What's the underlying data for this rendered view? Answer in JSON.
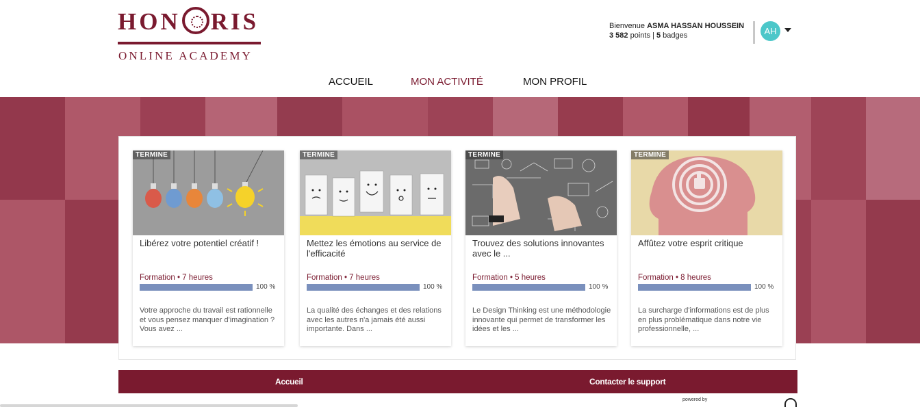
{
  "brand": {
    "logo_word": "HON",
    "logo_word_end": "RIS",
    "tagline": "ONLINE ACADEMY",
    "color": "#7a1a2f"
  },
  "user": {
    "greeting": "Bienvenue",
    "name": "ASMA HASSAN HOUSSEIN",
    "points_value": "3 582",
    "points_label": "points",
    "separator": "|",
    "badges_value": "5",
    "badges_label": "badges",
    "avatar_initials": "AH",
    "avatar_color": "#4cc7c9",
    "menu_icon": "caret-down-icon"
  },
  "nav": {
    "items": [
      {
        "label": "ACCUEIL",
        "active": false
      },
      {
        "label": "MON ACTIVITÉ",
        "active": true
      },
      {
        "label": "MON PROFIL",
        "active": false
      }
    ]
  },
  "courses": [
    {
      "status": "TERMINE",
      "title": "Libérez votre potentiel créatif !",
      "meta": "Formation • 7 heures",
      "progress": 1.0,
      "progress_label": "100 %",
      "description": "Votre approche du travail est rationnelle et vous pensez manquer d'imagination ? Vous avez ...",
      "image": "light-bulbs-image"
    },
    {
      "status": "TERMINE",
      "title": "Mettez les émotions au service de l'efficacité",
      "meta": "Formation • 7 heures",
      "progress": 1.0,
      "progress_label": "100 %",
      "description": "La qualité des échanges et des relations avec les autres n'a jamais été aussi importante. Dans ...",
      "image": "emotion-faces-image"
    },
    {
      "status": "TERMINE",
      "title": "Trouvez des solutions innovantes avec le ...",
      "meta": "Formation • 5 heures",
      "progress": 1.0,
      "progress_label": "100 %",
      "description": "Le Design Thinking est une méthodologie innovante qui permet de transformer les idées et les ...",
      "image": "chalkboard-sketch-image"
    },
    {
      "status": "TERMINE",
      "title": "Affûtez votre esprit critique",
      "meta": "Formation • 8 heures",
      "progress": 1.0,
      "progress_label": "100 %",
      "description": "La surcharge d'informations est de plus en plus problématique dans notre vie professionnelle, ...",
      "image": "head-maze-image"
    }
  ],
  "footer": {
    "links": [
      "Accueil",
      "Contacter le support"
    ],
    "powered_by": "powered by",
    "background": "#7a1a2f"
  }
}
